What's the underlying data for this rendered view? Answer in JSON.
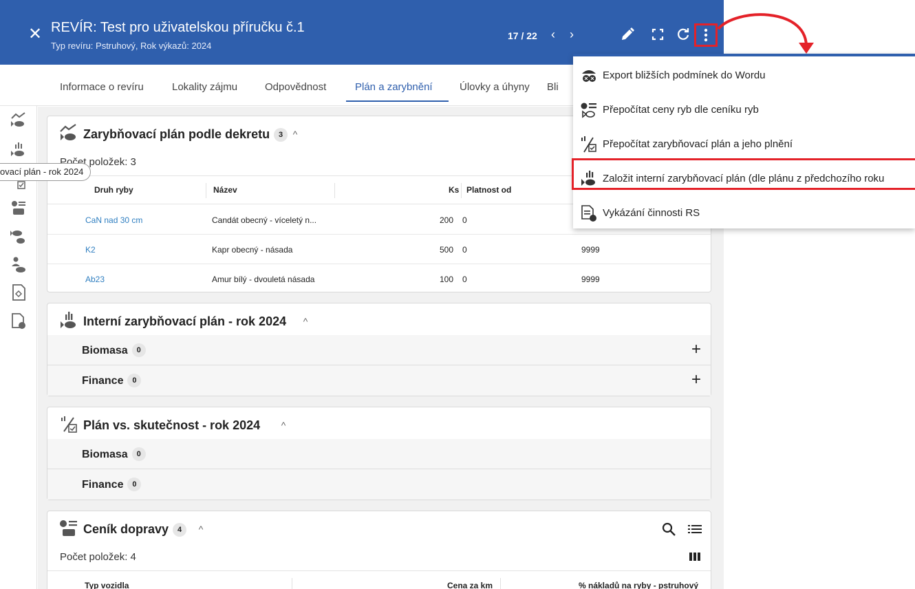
{
  "header": {
    "title": "REVÍR: Test pro uživatelskou příručku č.1",
    "subtitle": "Typ revíru: Pstruhový, Rok výkazů: 2024",
    "pager": "17 / 22",
    "close_icon": "close-icon",
    "icons": [
      "edit-icon",
      "fullscreen-icon",
      "refresh-icon",
      "more-vert-icon"
    ],
    "accent": "#2f5fad"
  },
  "tabs": [
    {
      "label": "Informace o revíru"
    },
    {
      "label": "Lokality zájmu"
    },
    {
      "label": "Odpovědnost"
    },
    {
      "label": "Plán a zarybnění",
      "active": true
    },
    {
      "label": "Úlovky a úhyny"
    },
    {
      "label": "Bli"
    }
  ],
  "tooltip": "ovací plán - rok 2024",
  "cards": {
    "dekret": {
      "title": "Zarybňovací plán podle dekretu",
      "badge": "3",
      "count": "Počet položek: 3",
      "columns": [
        "Druh ryby",
        "Název",
        "Ks",
        "Platnost od"
      ],
      "rows": [
        {
          "druh": "CaN nad 30 cm",
          "nazev": "Candát obecný - víceletý n...",
          "ks": "200",
          "od": "0",
          "do": "9999"
        },
        {
          "druh": "K2",
          "nazev": "Kapr obecný - násada",
          "ks": "500",
          "od": "0",
          "do": "9999"
        },
        {
          "druh": "Ab23",
          "nazev": "Amur bílý - dvouletá násada",
          "ks": "100",
          "od": "0",
          "do": "9999"
        }
      ]
    },
    "interni": {
      "title": "Interní zarybňovací plán - rok 2024",
      "rows": [
        {
          "label": "Biomasa",
          "badge": "0"
        },
        {
          "label": "Finance",
          "badge": "0"
        }
      ]
    },
    "plan_vs": {
      "title": "Plán vs. skutečnost - rok 2024",
      "rows": [
        {
          "label": "Biomasa",
          "badge": "0"
        },
        {
          "label": "Finance",
          "badge": "0"
        }
      ]
    },
    "cenik": {
      "title": "Ceník dopravy",
      "badge": "4",
      "count": "Počet položek: 4",
      "columns": [
        "Typ vozidla",
        "Cena za km",
        "% nákladů na ryby - pstruhový"
      ]
    }
  },
  "menu": {
    "items": [
      {
        "label": "Export bližších podmínek do Wordu",
        "icon": "word-export-icon"
      },
      {
        "label": "Přepočítat ceny ryb dle ceníku ryb",
        "icon": "recalc-prices-icon"
      },
      {
        "label": "Přepočítat zarybňovací plán a jeho plnění",
        "icon": "recalc-plan-icon"
      },
      {
        "label": "Založit interní zarybňovací plán (dle plánu z předchozího roku",
        "icon": "create-plan-icon",
        "highlighted": true
      },
      {
        "label": "Vykázání činnosti RS",
        "icon": "report-activity-icon"
      }
    ],
    "highlight_color": "#e42229"
  }
}
